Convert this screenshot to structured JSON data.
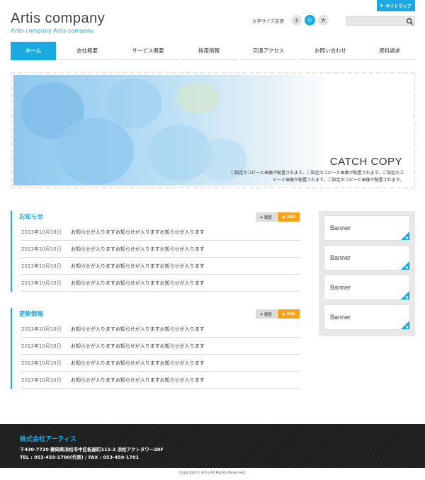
{
  "header": {
    "sitemap_label": "サイトマップ",
    "logo_main": "Artis company",
    "logo_sub": "Artis company Artis company",
    "font_size_label": "文字サイズ変更",
    "font_sizes": [
      "小",
      "中",
      "大"
    ],
    "search_placeholder": ""
  },
  "nav": {
    "items": [
      {
        "label": "ホーム"
      },
      {
        "label": "会社概要"
      },
      {
        "label": "サービス概要"
      },
      {
        "label": "採用情報"
      },
      {
        "label": "交通アクセス"
      },
      {
        "label": "お問い合わせ"
      },
      {
        "label": "資料請求"
      }
    ]
  },
  "hero": {
    "catch_title": "CATCH COPY",
    "catch_text": "ご指定のコピーと画像が配置されます。ご指定のコピーと画像が配置されます。ご指定のコピーと画像が配置されます。ご指定のコピーと画像が配置されます。"
  },
  "news": {
    "title": "お知らせ",
    "history_label": "履歴",
    "rss_label": "RSS",
    "items": [
      {
        "date": "2013年10月10日",
        "text": "お知らせが入りますお知らせが入りますお知らせが入ります"
      },
      {
        "date": "2013年10月10日",
        "text": "お知らせが入りますお知らせが入りますお知らせが入ります"
      },
      {
        "date": "2013年10月10日",
        "text": "お知らせが入りますお知らせが入りますお知らせが入ります"
      },
      {
        "date": "2013年10月10日",
        "text": "お知らせが入りますお知らせが入りますお知らせが入ります"
      }
    ]
  },
  "updates": {
    "title": "更新情報",
    "history_label": "履歴",
    "rss_label": "RSS",
    "items": [
      {
        "date": "2013年10月10日",
        "text": "お知らせが入りますお知らせが入りますお知らせが入ります"
      },
      {
        "date": "2013年10月10日",
        "text": "お知らせが入りますお知らせが入りますお知らせが入ります"
      },
      {
        "date": "2013年10月10日",
        "text": "お知らせが入りますお知らせが入りますお知らせが入ります"
      },
      {
        "date": "2013年10月10日",
        "text": "お知らせが入りますお知らせが入りますお知らせが入ります"
      }
    ]
  },
  "banners": [
    "Banner",
    "Banner",
    "Banner",
    "Banner"
  ],
  "footer": {
    "company": "株式会社アーティス",
    "address": "〒430-7720 静岡県浜松市中区板屋町111-2 浜松アクトタワー20F",
    "tel": "TEL : 053-459-1700(代表) / FAX : 053-459-1701",
    "copyright": "Copyright© Artis All Rights Reserved."
  },
  "colors": {
    "accent": "#1aa9e0",
    "rss": "#f6a21e",
    "footer_bg": "#222222"
  }
}
